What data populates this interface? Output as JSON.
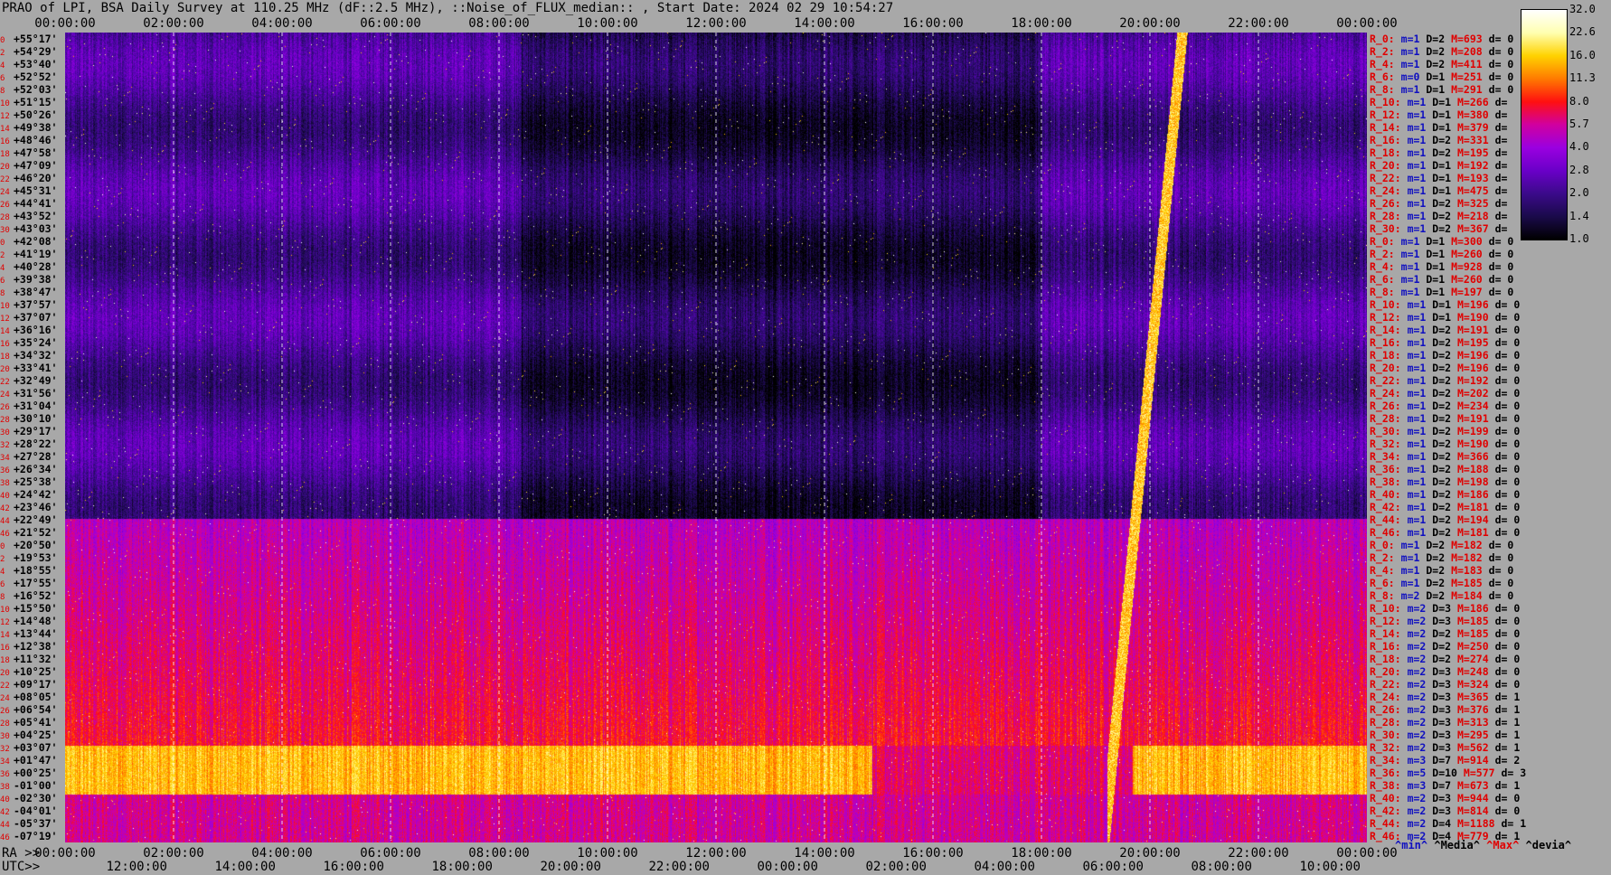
{
  "title": "PRAO of LPI, BSA Daily Survey at 110.25 MHz (dF::2.5 MHz), ::Noise_of_FLUX_median:: , Start Date: 2024 02 29 10:54:27",
  "chart_data": {
    "type": "heatmap",
    "top_axis_ticks": [
      "00:00:00",
      "02:00:00",
      "04:00:00",
      "06:00:00",
      "08:00:00",
      "10:00:00",
      "12:00:00",
      "14:00:00",
      "16:00:00",
      "18:00:00",
      "20:00:00",
      "22:00:00",
      "00:00:00"
    ],
    "bottom_ra_prefix": "RA >>",
    "bottom_ra_ticks": [
      "00:00:00",
      "02:00:00",
      "04:00:00",
      "06:00:00",
      "08:00:00",
      "10:00:00",
      "12:00:00",
      "14:00:00",
      "16:00:00",
      "18:00:00",
      "20:00:00",
      "22:00:00",
      "00:00:00"
    ],
    "bottom_utc_prefix": "UTC>>",
    "bottom_utc_ticks": [
      "12:00:00",
      "14:00:00",
      "16:00:00",
      "18:00:00",
      "20:00:00",
      "22:00:00",
      "00:00:00",
      "02:00:00",
      "04:00:00",
      "06:00:00",
      "08:00:00",
      "10:00:00"
    ],
    "colorbar_ticks": [
      "32.0",
      "22.6",
      "16.0",
      "11.3",
      "8.0",
      "5.7",
      "4.0",
      "2.8",
      "2.0",
      "1.4",
      "1.0"
    ],
    "colorbar_range": [
      1.0,
      32.0
    ],
    "colorbar_scale": "log",
    "colormap": [
      "#000000",
      "#1a0a4a",
      "#3b0a8a",
      "#6a00c8",
      "#9a00e0",
      "#d000a0",
      "#ff1010",
      "#ff7a00",
      "#ffd200",
      "#ffffb0",
      "#ffffff"
    ],
    "rows": [
      {
        "idx": "0",
        "dec": "+55°17'",
        "r": "R_0:",
        "m": "m=1",
        "d": "D=2",
        "mx": "M=693",
        "dv": "d= 0"
      },
      {
        "idx": "2",
        "dec": "+54°29'",
        "r": "R_2:",
        "m": "m=1",
        "d": "D=2",
        "mx": "M=208",
        "dv": "d= 0"
      },
      {
        "idx": "4",
        "dec": "+53°40'",
        "r": "R_4:",
        "m": "m=1",
        "d": "D=2",
        "mx": "M=411",
        "dv": "d= 0"
      },
      {
        "idx": "6",
        "dec": "+52°52'",
        "r": "R_6:",
        "m": "m=0",
        "d": "D=1",
        "mx": "M=251",
        "dv": "d= 0"
      },
      {
        "idx": "8",
        "dec": "+52°03'",
        "r": "R_8:",
        "m": "m=1",
        "d": "D=1",
        "mx": "M=291",
        "dv": "d= 0"
      },
      {
        "idx": "10",
        "dec": "+51°15'",
        "r": "R_10:",
        "m": "m=1",
        "d": "D=1",
        "mx": "M=266",
        "dv": "d="
      },
      {
        "idx": "12",
        "dec": "+50°26'",
        "r": "R_12:",
        "m": "m=1",
        "d": "D=1",
        "mx": "M=380",
        "dv": "d="
      },
      {
        "idx": "14",
        "dec": "+49°38'",
        "r": "R_14:",
        "m": "m=1",
        "d": "D=1",
        "mx": "M=379",
        "dv": "d="
      },
      {
        "idx": "16",
        "dec": "+48°46'",
        "r": "R_16:",
        "m": "m=1",
        "d": "D=2",
        "mx": "M=331",
        "dv": "d="
      },
      {
        "idx": "18",
        "dec": "+47°58'",
        "r": "R_18:",
        "m": "m=1",
        "d": "D=2",
        "mx": "M=195",
        "dv": "d="
      },
      {
        "idx": "20",
        "dec": "+47°09'",
        "r": "R_20:",
        "m": "m=1",
        "d": "D=1",
        "mx": "M=192",
        "dv": "d="
      },
      {
        "idx": "22",
        "dec": "+46°20'",
        "r": "R_22:",
        "m": "m=1",
        "d": "D=1",
        "mx": "M=193",
        "dv": "d="
      },
      {
        "idx": "24",
        "dec": "+45°31'",
        "r": "R_24:",
        "m": "m=1",
        "d": "D=1",
        "mx": "M=475",
        "dv": "d="
      },
      {
        "idx": "26",
        "dec": "+44°41'",
        "r": "R_26:",
        "m": "m=1",
        "d": "D=2",
        "mx": "M=325",
        "dv": "d="
      },
      {
        "idx": "28",
        "dec": "+43°52'",
        "r": "R_28:",
        "m": "m=1",
        "d": "D=2",
        "mx": "M=218",
        "dv": "d="
      },
      {
        "idx": "30",
        "dec": "+43°03'",
        "r": "R_30:",
        "m": "m=1",
        "d": "D=2",
        "mx": "M=367",
        "dv": "d="
      },
      {
        "idx": "0",
        "dec": "+42°08'",
        "r": "R_0:",
        "m": "m=1",
        "d": "D=1",
        "mx": "M=300",
        "dv": "d= 0"
      },
      {
        "idx": "2",
        "dec": "+41°19'",
        "r": "R_2:",
        "m": "m=1",
        "d": "D=1",
        "mx": "M=260",
        "dv": "d= 0"
      },
      {
        "idx": "4",
        "dec": "+40°28'",
        "r": "R_4:",
        "m": "m=1",
        "d": "D=1",
        "mx": "M=928",
        "dv": "d= 0"
      },
      {
        "idx": "6",
        "dec": "+39°38'",
        "r": "R_6:",
        "m": "m=1",
        "d": "D=1",
        "mx": "M=260",
        "dv": "d= 0"
      },
      {
        "idx": "8",
        "dec": "+38°47'",
        "r": "R_8:",
        "m": "m=1",
        "d": "D=1",
        "mx": "M=197",
        "dv": "d= 0"
      },
      {
        "idx": "10",
        "dec": "+37°57'",
        "r": "R_10:",
        "m": "m=1",
        "d": "D=1",
        "mx": "M=196",
        "dv": "d= 0"
      },
      {
        "idx": "12",
        "dec": "+37°07'",
        "r": "R_12:",
        "m": "m=1",
        "d": "D=1",
        "mx": "M=190",
        "dv": "d= 0"
      },
      {
        "idx": "14",
        "dec": "+36°16'",
        "r": "R_14:",
        "m": "m=1",
        "d": "D=2",
        "mx": "M=191",
        "dv": "d= 0"
      },
      {
        "idx": "16",
        "dec": "+35°24'",
        "r": "R_16:",
        "m": "m=1",
        "d": "D=2",
        "mx": "M=195",
        "dv": "d= 0"
      },
      {
        "idx": "18",
        "dec": "+34°32'",
        "r": "R_18:",
        "m": "m=1",
        "d": "D=2",
        "mx": "M=196",
        "dv": "d= 0"
      },
      {
        "idx": "20",
        "dec": "+33°41'",
        "r": "R_20:",
        "m": "m=1",
        "d": "D=2",
        "mx": "M=196",
        "dv": "d= 0"
      },
      {
        "idx": "22",
        "dec": "+32°49'",
        "r": "R_22:",
        "m": "m=1",
        "d": "D=2",
        "mx": "M=192",
        "dv": "d= 0"
      },
      {
        "idx": "24",
        "dec": "+31°56'",
        "r": "R_24:",
        "m": "m=1",
        "d": "D=2",
        "mx": "M=202",
        "dv": "d= 0"
      },
      {
        "idx": "26",
        "dec": "+31°04'",
        "r": "R_26:",
        "m": "m=1",
        "d": "D=2",
        "mx": "M=234",
        "dv": "d= 0"
      },
      {
        "idx": "28",
        "dec": "+30°10'",
        "r": "R_28:",
        "m": "m=1",
        "d": "D=2",
        "mx": "M=191",
        "dv": "d= 0"
      },
      {
        "idx": "30",
        "dec": "+29°17'",
        "r": "R_30:",
        "m": "m=1",
        "d": "D=2",
        "mx": "M=199",
        "dv": "d= 0"
      },
      {
        "idx": "32",
        "dec": "+28°22'",
        "r": "R_32:",
        "m": "m=1",
        "d": "D=2",
        "mx": "M=190",
        "dv": "d= 0"
      },
      {
        "idx": "34",
        "dec": "+27°28'",
        "r": "R_34:",
        "m": "m=1",
        "d": "D=2",
        "mx": "M=366",
        "dv": "d= 0"
      },
      {
        "idx": "36",
        "dec": "+26°34'",
        "r": "R_36:",
        "m": "m=1",
        "d": "D=2",
        "mx": "M=188",
        "dv": "d= 0"
      },
      {
        "idx": "38",
        "dec": "+25°38'",
        "r": "R_38:",
        "m": "m=1",
        "d": "D=2",
        "mx": "M=198",
        "dv": "d= 0"
      },
      {
        "idx": "40",
        "dec": "+24°42'",
        "r": "R_40:",
        "m": "m=1",
        "d": "D=2",
        "mx": "M=186",
        "dv": "d= 0"
      },
      {
        "idx": "42",
        "dec": "+23°46'",
        "r": "R_42:",
        "m": "m=1",
        "d": "D=2",
        "mx": "M=181",
        "dv": "d= 0"
      },
      {
        "idx": "44",
        "dec": "+22°49'",
        "r": "R_44:",
        "m": "m=1",
        "d": "D=2",
        "mx": "M=194",
        "dv": "d= 0"
      },
      {
        "idx": "46",
        "dec": "+21°52'",
        "r": "R_46:",
        "m": "m=1",
        "d": "D=2",
        "mx": "M=181",
        "dv": "d= 0"
      },
      {
        "idx": "0",
        "dec": "+20°50'",
        "r": "R_0:",
        "m": "m=1",
        "d": "D=2",
        "mx": "M=182",
        "dv": "d= 0"
      },
      {
        "idx": "2",
        "dec": "+19°53'",
        "r": "R_2:",
        "m": "m=1",
        "d": "D=2",
        "mx": "M=182",
        "dv": "d= 0"
      },
      {
        "idx": "4",
        "dec": "+18°55'",
        "r": "R_4:",
        "m": "m=1",
        "d": "D=2",
        "mx": "M=183",
        "dv": "d= 0"
      },
      {
        "idx": "6",
        "dec": "+17°55'",
        "r": "R_6:",
        "m": "m=1",
        "d": "D=2",
        "mx": "M=185",
        "dv": "d= 0"
      },
      {
        "idx": "8",
        "dec": "+16°52'",
        "r": "R_8:",
        "m": "m=2",
        "d": "D=2",
        "mx": "M=184",
        "dv": "d= 0"
      },
      {
        "idx": "10",
        "dec": "+15°50'",
        "r": "R_10:",
        "m": "m=2",
        "d": "D=3",
        "mx": "M=186",
        "dv": "d= 0"
      },
      {
        "idx": "12",
        "dec": "+14°48'",
        "r": "R_12:",
        "m": "m=2",
        "d": "D=3",
        "mx": "M=185",
        "dv": "d= 0"
      },
      {
        "idx": "14",
        "dec": "+13°44'",
        "r": "R_14:",
        "m": "m=2",
        "d": "D=2",
        "mx": "M=185",
        "dv": "d= 0"
      },
      {
        "idx": "16",
        "dec": "+12°38'",
        "r": "R_16:",
        "m": "m=2",
        "d": "D=2",
        "mx": "M=250",
        "dv": "d= 0"
      },
      {
        "idx": "18",
        "dec": "+11°32'",
        "r": "R_18:",
        "m": "m=2",
        "d": "D=2",
        "mx": "M=274",
        "dv": "d= 0"
      },
      {
        "idx": "20",
        "dec": "+10°25'",
        "r": "R_20:",
        "m": "m=2",
        "d": "D=3",
        "mx": "M=248",
        "dv": "d= 0"
      },
      {
        "idx": "22",
        "dec": "+09°17'",
        "r": "R_22:",
        "m": "m=2",
        "d": "D=3",
        "mx": "M=324",
        "dv": "d= 0"
      },
      {
        "idx": "24",
        "dec": "+08°05'",
        "r": "R_24:",
        "m": "m=2",
        "d": "D=3",
        "mx": "M=365",
        "dv": "d= 1"
      },
      {
        "idx": "26",
        "dec": "+06°54'",
        "r": "R_26:",
        "m": "m=2",
        "d": "D=3",
        "mx": "M=376",
        "dv": "d= 1"
      },
      {
        "idx": "28",
        "dec": "+05°41'",
        "r": "R_28:",
        "m": "m=2",
        "d": "D=3",
        "mx": "M=313",
        "dv": "d= 1"
      },
      {
        "idx": "30",
        "dec": "+04°25'",
        "r": "R_30:",
        "m": "m=2",
        "d": "D=3",
        "mx": "M=295",
        "dv": "d= 1"
      },
      {
        "idx": "32",
        "dec": "+03°07'",
        "r": "R_32:",
        "m": "m=2",
        "d": "D=3",
        "mx": "M=562",
        "dv": "d= 1"
      },
      {
        "idx": "34",
        "dec": "+01°47'",
        "r": "R_34:",
        "m": "m=3",
        "d": "D=7",
        "mx": "M=914",
        "dv": "d= 2"
      },
      {
        "idx": "36",
        "dec": "+00°25'",
        "r": "R_36:",
        "m": "m=5",
        "d": "D=10",
        "mx": "M=577",
        "dv": "d= 3"
      },
      {
        "idx": "38",
        "dec": "-01°00'",
        "r": "R_38:",
        "m": "m=3",
        "d": "D=7",
        "mx": "M=673",
        "dv": "d= 1"
      },
      {
        "idx": "40",
        "dec": "-02°30'",
        "r": "R_40:",
        "m": "m=2",
        "d": "D=3",
        "mx": "M=944",
        "dv": "d= 0"
      },
      {
        "idx": "42",
        "dec": "-04°01'",
        "r": "R_42:",
        "m": "m=2",
        "d": "D=3",
        "mx": "M=814",
        "dv": "d= 0"
      },
      {
        "idx": "44",
        "dec": "-05°37'",
        "r": "R_44:",
        "m": "m=2",
        "d": "D=4",
        "mx": "M=1188",
        "dv": "d= 1"
      },
      {
        "idx": "46",
        "dec": "-07°19'",
        "r": "R_46:",
        "m": "m=2",
        "d": "D=4",
        "mx": "M=779",
        "dv": "d= 1"
      }
    ],
    "footer_legend": {
      "min": "^min^",
      "median": "^Media^",
      "max": "^Max^",
      "dev": "^devia^"
    }
  }
}
